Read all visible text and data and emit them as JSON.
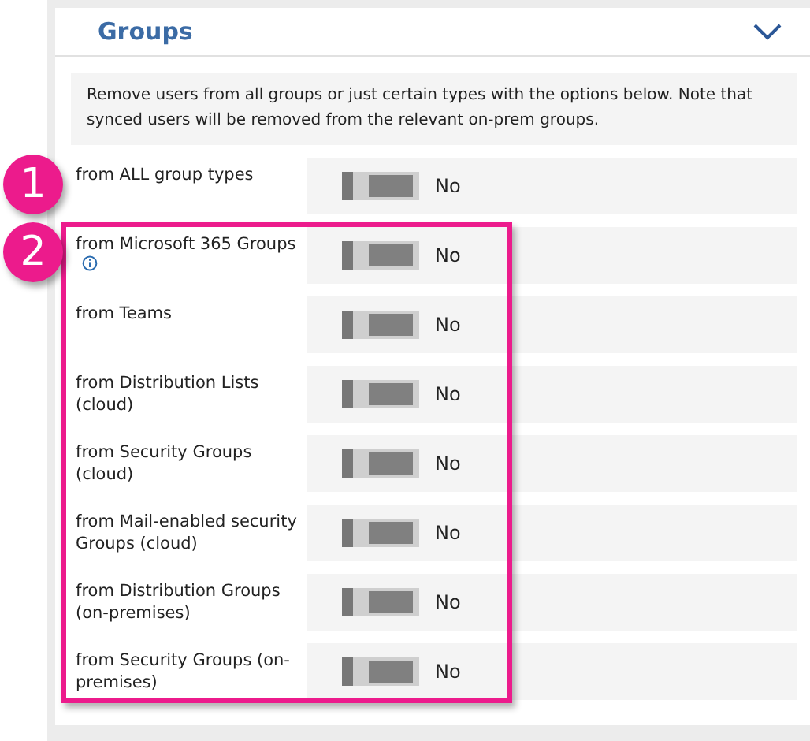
{
  "panel": {
    "title": "Groups",
    "expanded": true
  },
  "info_text": "Remove users from all groups or just certain types with the options below. Note that synced users will be removed from the relevant on-prem groups.",
  "sections": [
    {
      "callout": "1",
      "highlighted": false,
      "rows": [
        {
          "label": "from ALL group types",
          "on": false,
          "value": "No"
        }
      ]
    },
    {
      "callout": "2",
      "highlighted": true,
      "rows": [
        {
          "label": "from Microsoft 365 Groups",
          "info_icon": true,
          "on": false,
          "value": "No"
        },
        {
          "label": "from Teams",
          "on": false,
          "value": "No"
        },
        {
          "label": "from Distribution Lists (cloud)",
          "on": false,
          "value": "No"
        },
        {
          "label": "from Security Groups (cloud)",
          "on": false,
          "value": "No"
        },
        {
          "label": "from Mail-enabled security Groups (cloud)",
          "on": false,
          "value": "No"
        },
        {
          "label": "from Distribution Groups (on-premises)",
          "on": false,
          "value": "No"
        },
        {
          "label": "from Security Groups (on-premises)",
          "on": false,
          "value": "No"
        }
      ]
    }
  ]
}
